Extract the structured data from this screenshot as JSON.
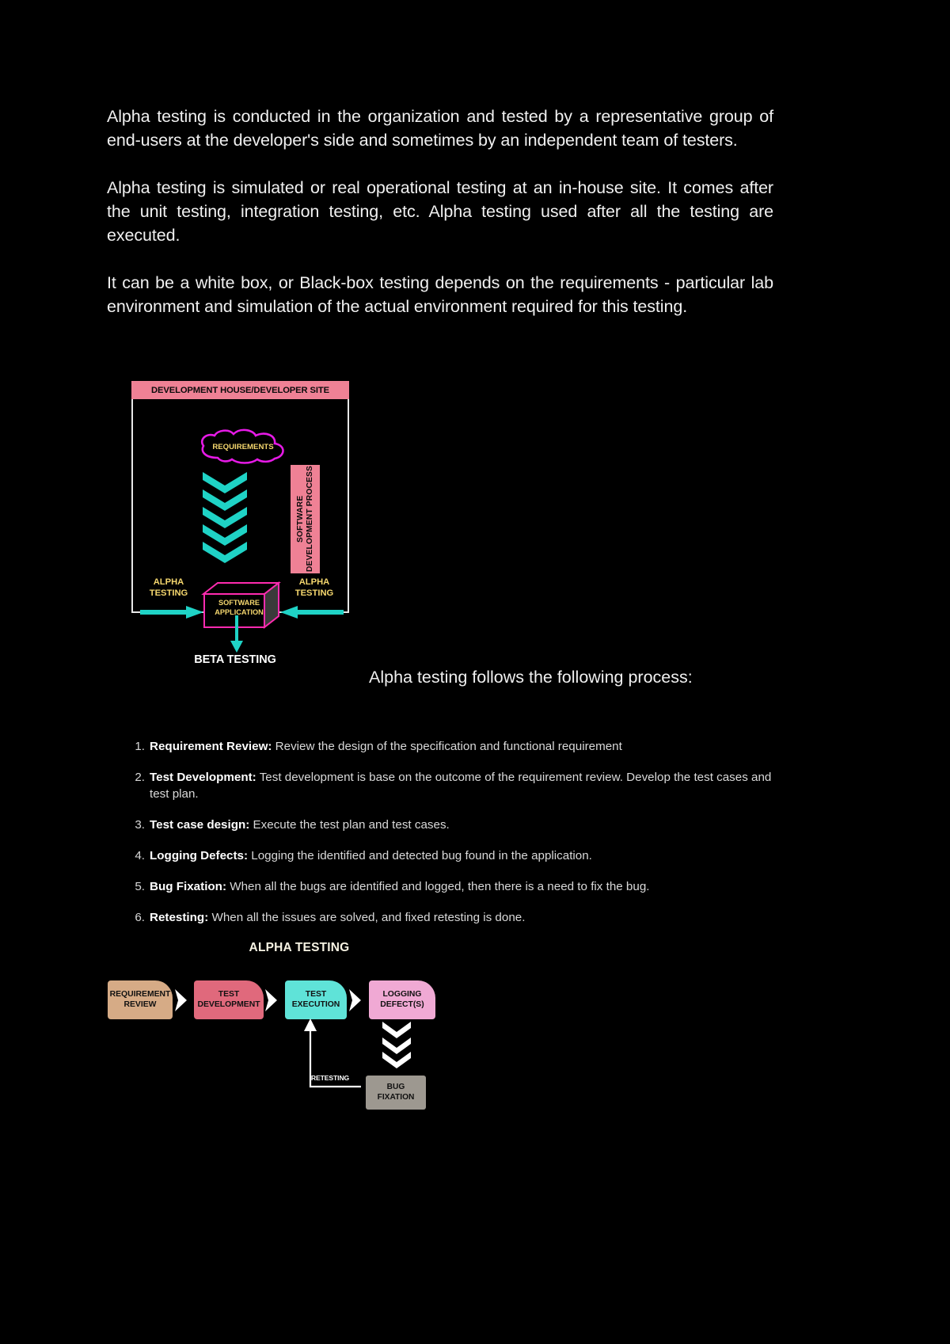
{
  "document": {
    "background_color": "#000000",
    "text_color": "#f0f0f0",
    "paragraphs": [
      "Alpha testing is conducted in the organization and tested by a representative group of end-users at the developer's side and sometimes by an independent team of testers.",
      "Alpha testing is simulated or real operational testing at an in-house site. It comes after the unit testing, integration testing, etc. Alpha testing used after all the testing are executed.",
      "It can be a white box, or Black-box testing depends on the requirements - particular lab environment and simulation of the actual environment required for this testing."
    ],
    "follows_line": "Alpha testing follows the following process:"
  },
  "diagram_alpha_context": {
    "header": "DEVELOPMENT HOUSE/DEVELOPER SITE",
    "header_bg": "#ef8195",
    "cloud_label": "REQUIREMENTS",
    "cloud_stroke": "#e61ae6",
    "cloud_text_color": "#f5d76e",
    "arrow_color": "#1fd3c6",
    "process_bar_label": "SOFTWARE DEVELOPMENT PROCESS",
    "process_bar_bg": "#ef8195",
    "alpha_left_line1": "ALPHA",
    "alpha_left_line2": "TESTING",
    "alpha_right_line1": "ALPHA",
    "alpha_right_line2": "TESTING",
    "app_box_line1": "SOFTWARE",
    "app_box_line2": "APPLICATION",
    "app_box_stroke": "#ff2bb0",
    "beta_label": "BETA TESTING",
    "border_color": "#e8e8e8"
  },
  "steps": [
    {
      "num": "1.",
      "term": "Requirement Review:",
      "text": " Review the design of the specification and functional requirement"
    },
    {
      "num": "2.",
      "term": "Test Development:",
      "text": " Test development is base on the outcome of the requirement review. Develop the test cases and test plan."
    },
    {
      "num": "3.",
      "term": "Test case design:",
      "text": " Execute the test plan and test cases."
    },
    {
      "num": "4.",
      "term": "Logging Defects:",
      "text": " Logging the identified and detected bug found in the application."
    },
    {
      "num": "5.",
      "term": "Bug Fixation:",
      "text": " When all the bugs are identified and logged, then there is a need to fix the bug."
    },
    {
      "num": "6.",
      "term": "Retesting:",
      "text": " When all the issues are solved, and fixed retesting is done."
    }
  ],
  "diagram_alpha_process": {
    "title": "ALPHA TESTING",
    "steps": [
      {
        "line1": "REQUIREMENT",
        "line2": "REVIEW",
        "color": "#d6ab86"
      },
      {
        "line1": "TEST",
        "line2": "DEVELOPMENT",
        "color": "#e0697c"
      },
      {
        "line1": "TEST",
        "line2": "EXECUTION",
        "color": "#5fe3d8"
      },
      {
        "line1": "LOGGING",
        "line2": "DEFECT(S)",
        "color": "#f0a9d4"
      }
    ],
    "bug_fixation_line1": "BUG",
    "bug_fixation_line2": "FIXATION",
    "bug_fixation_color": "#9d9890",
    "retesting_label": "RETESTING",
    "separator_color": "#ffffff"
  }
}
